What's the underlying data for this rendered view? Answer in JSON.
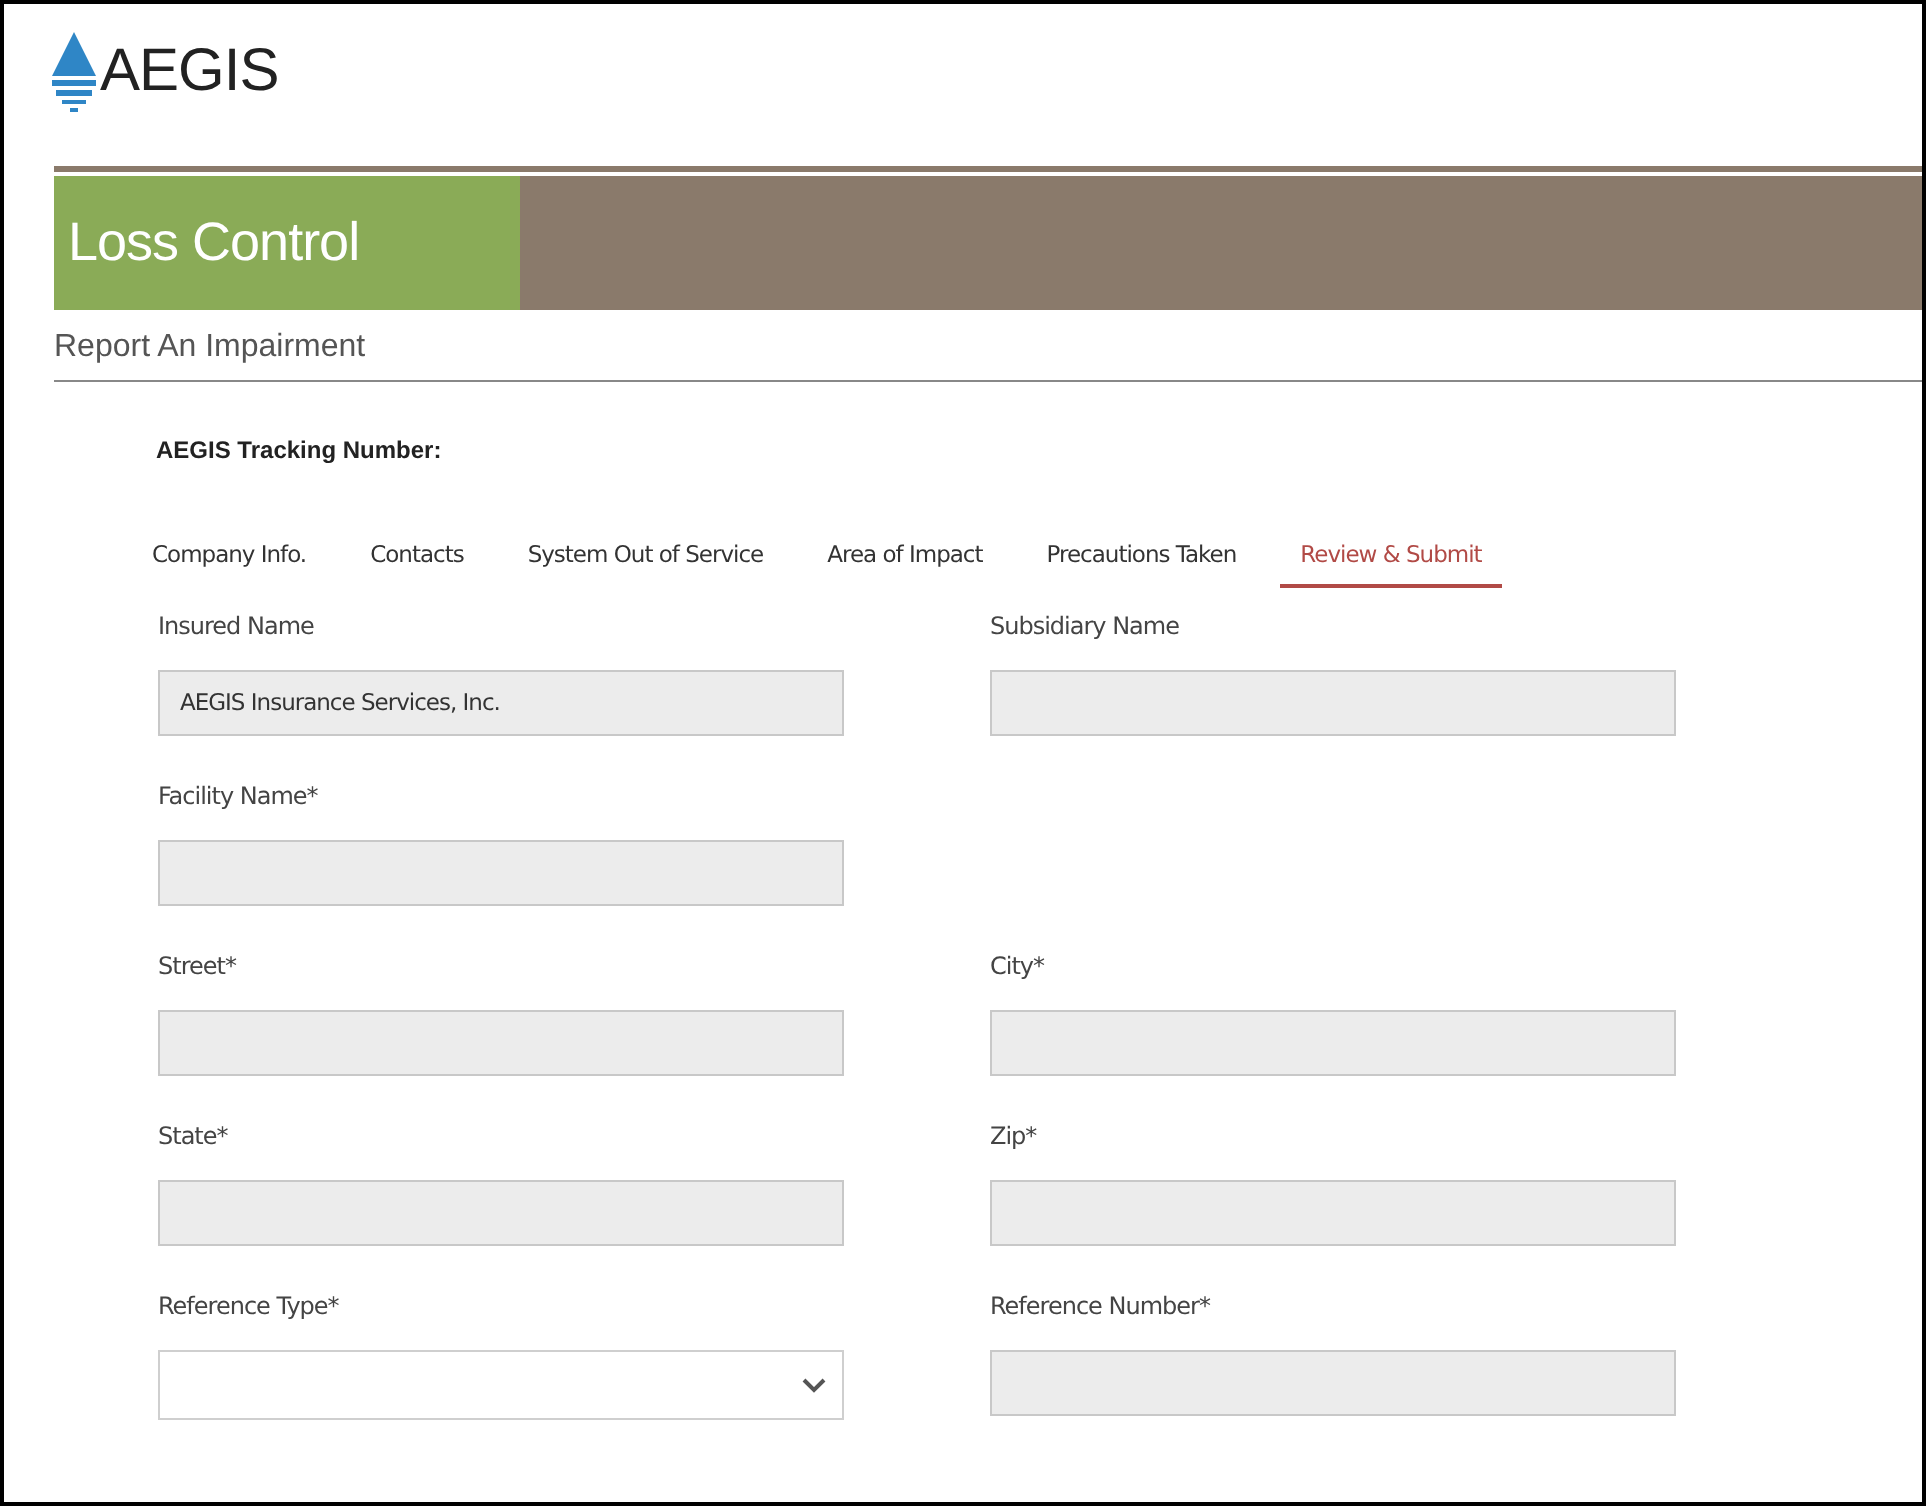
{
  "logo": {
    "text": "AEGIS"
  },
  "banner": {
    "title": "Loss Control"
  },
  "page_title": "Report An Impairment",
  "tracking": {
    "label": "AEGIS Tracking Number:"
  },
  "tabs": [
    {
      "label": "Company Info.",
      "selected": false
    },
    {
      "label": "Contacts",
      "selected": false
    },
    {
      "label": "System Out of Service",
      "selected": false
    },
    {
      "label": "Area of Impact",
      "selected": false
    },
    {
      "label": "Precautions Taken",
      "selected": false
    },
    {
      "label": "Review & Submit",
      "selected": true
    }
  ],
  "form_rows": [
    [
      {
        "label": "Insured Name",
        "kind": "text",
        "value": "AEGIS Insurance Services, Inc.",
        "disabled": true
      },
      {
        "label": "Subsidiary Name",
        "kind": "text",
        "disabled": true
      }
    ],
    [
      {
        "label": "Facility Name*",
        "kind": "text",
        "disabled": true
      }
    ],
    [
      {
        "label": "Street*",
        "kind": "text",
        "disabled": true
      },
      {
        "label": "City*",
        "kind": "text",
        "disabled": true
      }
    ],
    [
      {
        "label": "State*",
        "kind": "text",
        "disabled": true
      },
      {
        "label": "Zip*",
        "kind": "text",
        "disabled": true
      }
    ],
    [
      {
        "label": "Reference Type*",
        "kind": "select",
        "disabled": false
      },
      {
        "label": "Reference Number*",
        "kind": "text",
        "disabled": true
      }
    ]
  ]
}
